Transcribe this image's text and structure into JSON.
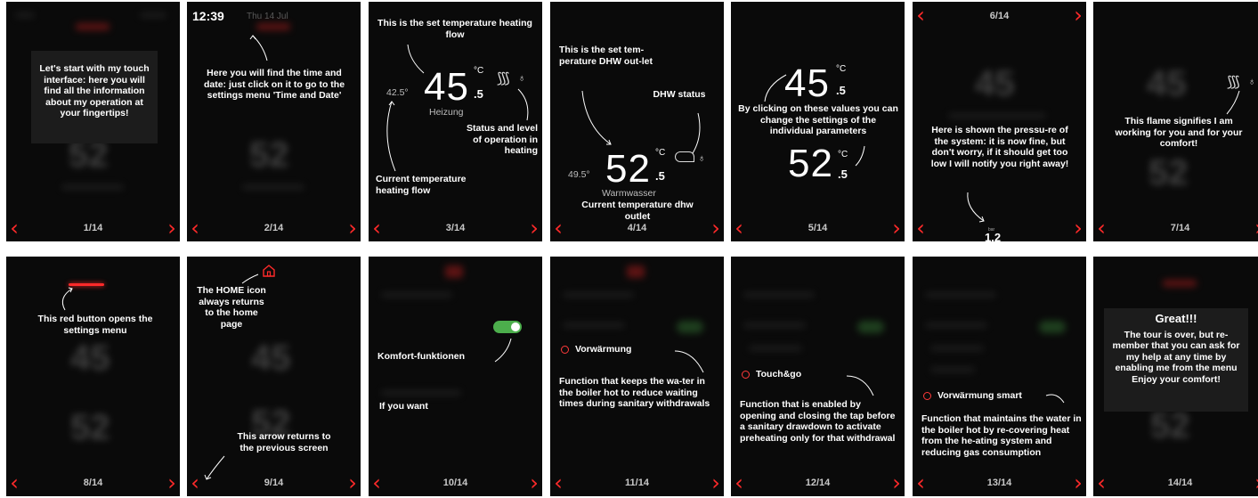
{
  "screens": [
    {
      "page": "1/14",
      "text": "Let's start with my touch interface: here you will find all the information about my operation at your fingertips!"
    },
    {
      "page": "2/14",
      "time": "12:39",
      "date": "Thu 14 Jul",
      "text": "Here you will find the time and date: just click on it to go to the settings menu 'Time and Date'"
    },
    {
      "page": "3/14",
      "text_top": "This is the set temperature heating flow",
      "current_value": "42.5°",
      "set_value": "45",
      "set_decimal": ".5",
      "unit": "°C",
      "zone_label": "Heizung",
      "text_status": "Status and level of operation in heating",
      "text_current": "Current temperature heating flow"
    },
    {
      "page": "4/14",
      "text_top": "This is the set tem-perature DHW out-let",
      "text_status": "DHW status",
      "current_value": "49.5°",
      "set_value": "52",
      "set_decimal": ".5",
      "unit": "°C",
      "zone_label": "Warmwasser",
      "text_current": "Current temperature dhw outlet"
    },
    {
      "page": "5/14",
      "value1": "45",
      "dec1": ".5",
      "unit": "°C",
      "value2": "52",
      "dec2": ".5",
      "text": "By clicking on these values you can change the settings of the individual parameters"
    },
    {
      "page_top": "6/14",
      "page": "",
      "text": "Here is shown the pressu-re of the system: it is now fine, but don't worry, if it should get too low I will notify you right away!",
      "pressure_unit": "bar",
      "pressure": "1.2"
    },
    {
      "page": "7/14",
      "text": "This flame signifies I am working for you and for your comfort!"
    },
    {
      "page": "8/14",
      "text": "This red button opens the settings menu"
    },
    {
      "page": "9/14",
      "text_home": "The HOME icon always returns to the home page",
      "text_arrow": "This arrow returns to the previous screen"
    },
    {
      "page": "10/14",
      "label": "Komfort-funktionen",
      "sub": "If you want"
    },
    {
      "page": "11/14",
      "item": "Vorwärmung",
      "text": "Function that keeps the wa-ter in the boiler hot to reduce waiting times during sanitary withdrawals"
    },
    {
      "page": "12/14",
      "item": "Touch&go",
      "text": "Function that is enabled by opening and closing the tap before a sanitary drawdown to activate preheating only for that withdrawal"
    },
    {
      "page": "13/14",
      "item": "Vorwärmung smart",
      "text": "Function that maintains the water in the boiler hot by re-covering heat from the he-ating system and reducing gas consumption"
    },
    {
      "page": "14/14",
      "title": "Great!!!",
      "text": "The tour is over, but re-member that you can ask for my help at any time by enabling me from the menu Enjoy your comfort!"
    }
  ],
  "nav": {
    "prev_icon": "‹",
    "next_icon": "›"
  },
  "colors": {
    "accent": "#ff2a2a",
    "toggle": "#4cae4c",
    "background": "#0a0a0a",
    "callout": "#1c1c1c"
  }
}
